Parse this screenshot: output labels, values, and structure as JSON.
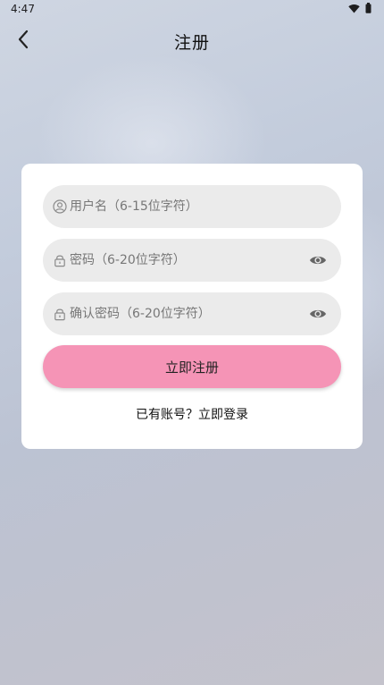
{
  "status_bar": {
    "time": "4:47"
  },
  "header": {
    "title": "注册",
    "back_icon": "chevron-left-icon"
  },
  "form": {
    "username_placeholder": "用户名（6-15位字符）",
    "password_placeholder": "密码（6-20位字符）",
    "confirm_password_placeholder": "确认密码（6-20位字符）",
    "submit_label": "立即注册",
    "login_link": "已有账号？立即登录"
  },
  "colors": {
    "accent": "#f594b6",
    "field_background": "#ebebeb",
    "card_background": "#ffffff"
  },
  "icons": [
    "user-circle-icon",
    "lock-icon",
    "eye-icon",
    "wifi-icon",
    "battery-icon"
  ]
}
